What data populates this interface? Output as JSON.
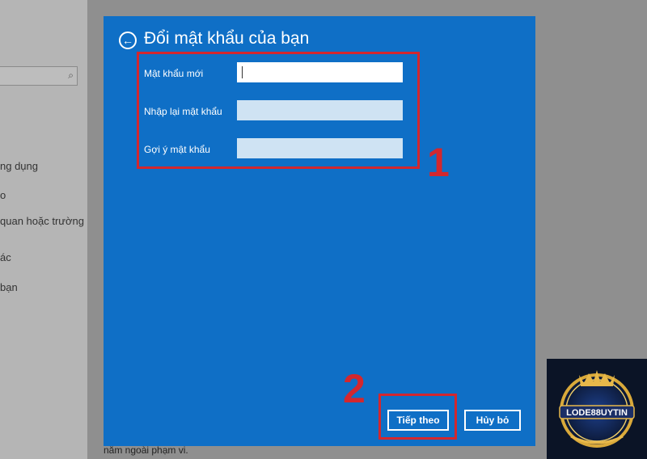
{
  "left_panel": {
    "items": [
      "ng dụng",
      "o",
      "quan hoặc trường",
      "ác",
      "bạn"
    ]
  },
  "bottom_text": "nằm ngoài phạm vi.",
  "dialog": {
    "title": "Đổi mật khẩu của bạn",
    "fields": {
      "new_password": {
        "label": "Mật khẩu mới",
        "value": ""
      },
      "confirm_password": {
        "label": "Nhập lại mật khẩu",
        "value": ""
      },
      "hint": {
        "label": "Gợi ý mật khẩu",
        "value": ""
      }
    },
    "buttons": {
      "next": "Tiếp theo",
      "cancel": "Hủy bỏ"
    }
  },
  "annotations": {
    "step1": "1",
    "step2": "2"
  },
  "watermark": {
    "brand": "LODE88UYTIN"
  },
  "colors": {
    "dialog_bg": "#0f6fc6",
    "highlight": "#d3272e"
  }
}
